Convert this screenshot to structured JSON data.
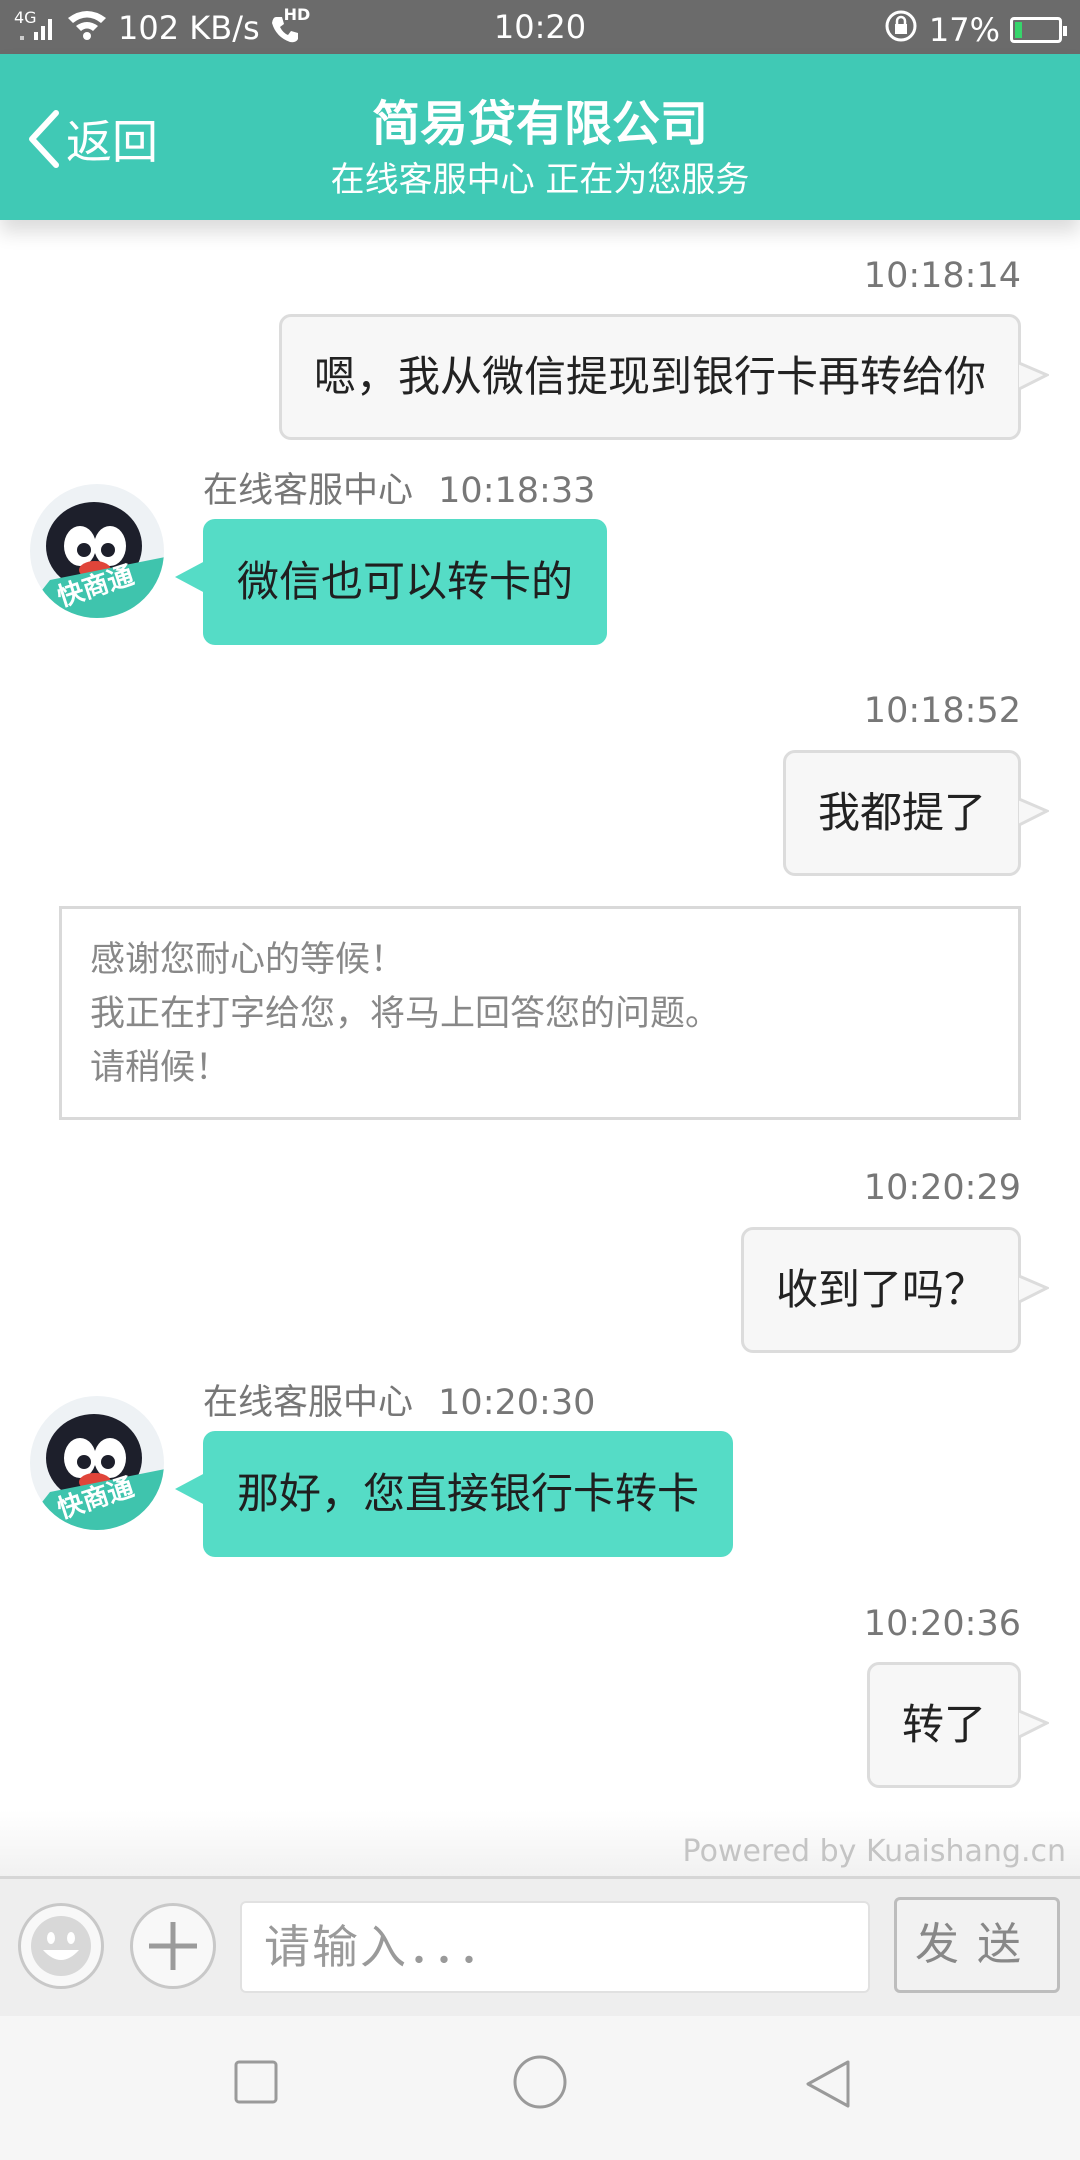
{
  "status_bar": {
    "network": "4G",
    "speed": "102 KB/s",
    "hd": "HD",
    "time": "10:20",
    "battery": "17%",
    "battery_level": 0.17
  },
  "header": {
    "back_label": "返回",
    "title": "简易贷有限公司",
    "subtitle": "在线客服中心 正在为您服务"
  },
  "messages": {
    "m1": {
      "time": "10:18:14",
      "text": "嗯，我从微信提现到银行卡再转给你"
    },
    "m2": {
      "sender": "在线客服中心",
      "time": "10:18:33",
      "text": "微信也可以转卡的"
    },
    "m3": {
      "time": "10:18:52",
      "text": "我都提了"
    },
    "notice": {
      "line1": "感谢您耐心的等候！",
      "line2": "我正在打字给您，将马上回答您的问题。",
      "line3": "请稍候！"
    },
    "m4": {
      "time": "10:20:29",
      "text": "收到了吗？"
    },
    "m5": {
      "sender": "在线客服中心",
      "time": "10:20:30",
      "text": "那好，您直接银行卡转卡"
    },
    "m6": {
      "time": "10:20:36",
      "text": "转了"
    }
  },
  "avatar_badge": "快商通",
  "powered_by": "Powered by Kuaishang.cn",
  "input": {
    "placeholder": "请输入．．．",
    "send_label": "发送"
  },
  "colors": {
    "header": "#40c9b5",
    "agent_bubble": "#55dcc6",
    "status_bar": "#6b6b6b"
  }
}
